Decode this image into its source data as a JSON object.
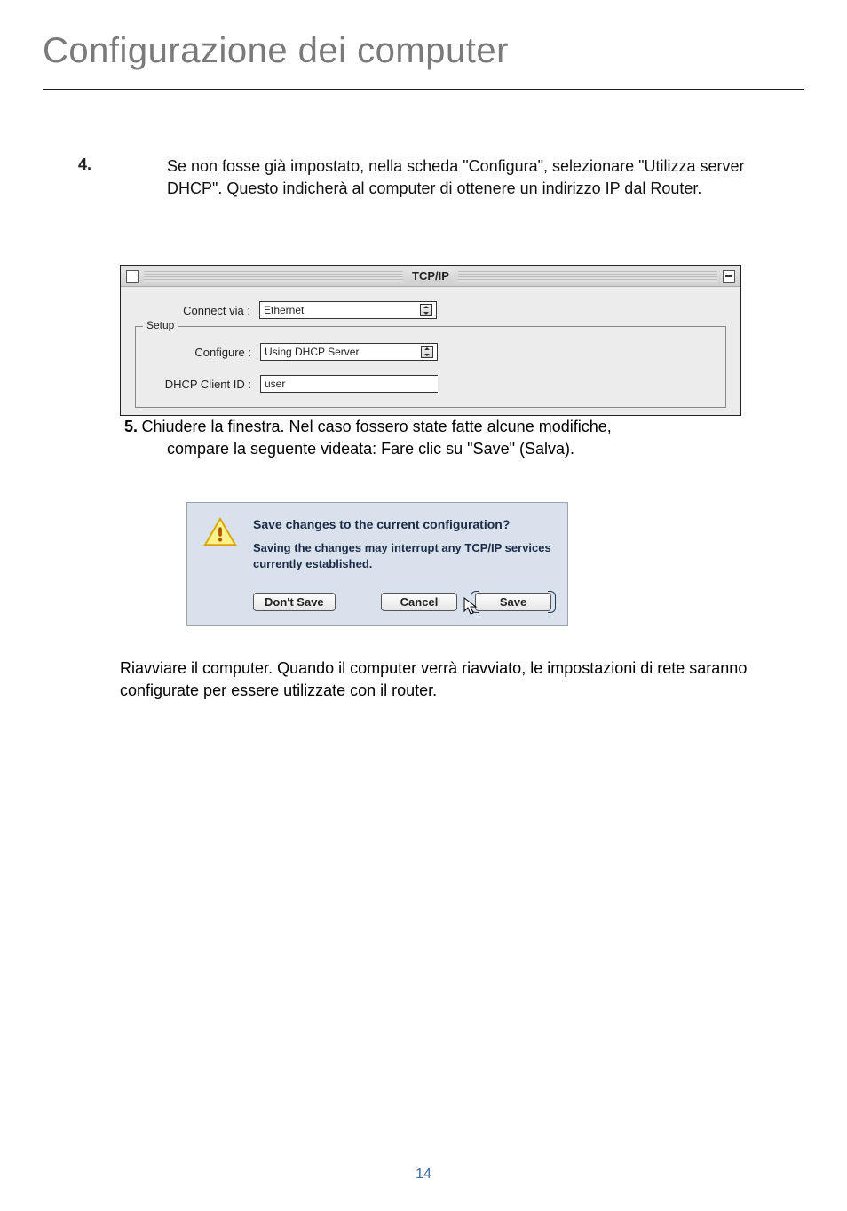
{
  "page": {
    "title": "Configurazione dei computer",
    "number": "14"
  },
  "step4": {
    "num": "4.",
    "text": "Se non fosse già impostato, nella scheda \"Configura\", selezionare \"Utilizza server DHCP\". Questo indicherà al computer di ottenere un indirizzo IP dal Router."
  },
  "tcpip": {
    "title": "TCP/IP",
    "connect_label": "Connect via :",
    "connect_value": "Ethernet",
    "setup_legend": "Setup",
    "configure_label": "Configure :",
    "configure_value": "Using DHCP Server",
    "client_label": "DHCP Client ID :",
    "client_value": "user"
  },
  "step5": {
    "num": "5.",
    "text_a": "Chiudere la finestra. Nel caso fossero state fatte alcune modifiche,",
    "text_b": "compare la seguente videata: Fare clic su \"Save\" (Salva)."
  },
  "dialog": {
    "heading": "Save changes to the current configuration?",
    "subtext": "Saving the changes may interrupt any TCP/IP services currently established.",
    "dont_save": "Don't Save",
    "cancel": "Cancel",
    "save": "Save"
  },
  "final_text": "Riavviare il computer. Quando il computer verrà riavviato, le impostazioni di rete saranno configurate per essere utilizzate con il router."
}
